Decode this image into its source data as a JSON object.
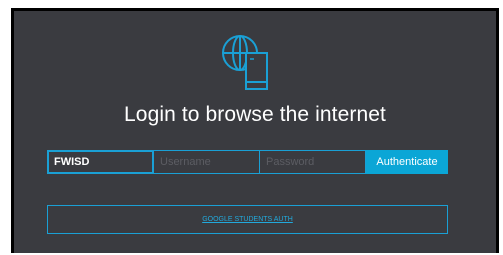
{
  "login": {
    "title": "Login to browse the internet",
    "school_value": "FWISD",
    "username_placeholder": "Username",
    "password_placeholder": "Password",
    "authenticate_label": "Authenticate",
    "google_auth_label": "GOOGLE STUDENTS AUTH"
  },
  "icons": {
    "logo": "globe-phone-icon"
  },
  "colors": {
    "background": "#3a3b40",
    "accent": "#0ba6d6",
    "frame": "#000000",
    "text": "#ffffff"
  }
}
